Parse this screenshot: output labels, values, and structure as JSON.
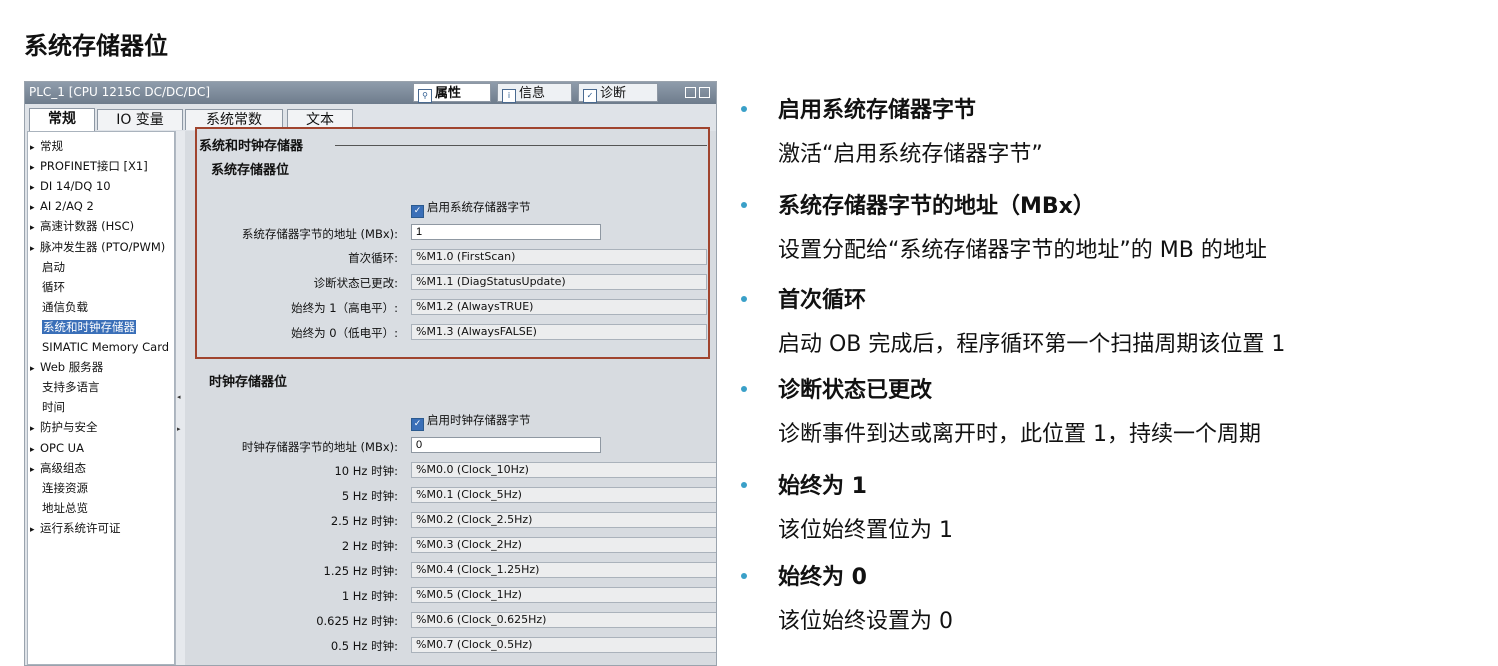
{
  "slide_title": "系统存储器位",
  "window": {
    "title": "PLC_1 [CPU 1215C DC/DC/DC]",
    "inspector_tabs": [
      {
        "label": "属性",
        "icon": "properties-icon"
      },
      {
        "label": "信息",
        "icon": "info-icon"
      },
      {
        "label": "诊断",
        "icon": "diagnostics-icon"
      }
    ],
    "sub_tabs": [
      "常规",
      "IO 变量",
      "系统常数",
      "文本"
    ]
  },
  "nav": {
    "items": [
      {
        "label": "常规",
        "arrow": "▸"
      },
      {
        "label": "PROFINET接口 [X1]",
        "arrow": "▸"
      },
      {
        "label": "DI 14/DQ 10",
        "arrow": "▸"
      },
      {
        "label": "AI 2/AQ 2",
        "arrow": "▸"
      },
      {
        "label": "高速计数器 (HSC)",
        "arrow": "▸"
      },
      {
        "label": "脉冲发生器 (PTO/PWM)",
        "arrow": "▸"
      },
      {
        "label": "启动",
        "arrow": ""
      },
      {
        "label": "循环",
        "arrow": ""
      },
      {
        "label": "通信负载",
        "arrow": ""
      },
      {
        "label": "系统和时钟存储器",
        "arrow": ""
      },
      {
        "label": "SIMATIC Memory Card",
        "arrow": ""
      },
      {
        "label": "Web 服务器",
        "arrow": "▸"
      },
      {
        "label": "支持多语言",
        "arrow": ""
      },
      {
        "label": "时间",
        "arrow": ""
      },
      {
        "label": "防护与安全",
        "arrow": "▸"
      },
      {
        "label": "OPC UA",
        "arrow": "▸"
      },
      {
        "label": "高级组态",
        "arrow": "▸"
      },
      {
        "label": "连接资源",
        "arrow": ""
      },
      {
        "label": "地址总览",
        "arrow": ""
      },
      {
        "label": "运行系统许可证",
        "arrow": "▸"
      }
    ]
  },
  "system_memory": {
    "group_title": "系统和时钟存储器",
    "title": "系统存储器位",
    "enable_label": "启用系统存储器字节",
    "address_label": "系统存储器字节的地址 (MBx):",
    "address_value": "1",
    "rows": [
      {
        "label": "首次循环:",
        "value": "%M1.0 (FirstScan)"
      },
      {
        "label": "诊断状态已更改:",
        "value": "%M1.1 (DiagStatusUpdate)"
      },
      {
        "label": "始终为 1（高电平）:",
        "value": "%M1.2 (AlwaysTRUE)"
      },
      {
        "label": "始终为 0（低电平）:",
        "value": "%M1.3 (AlwaysFALSE)"
      }
    ]
  },
  "clock_memory": {
    "title": "时钟存储器位",
    "enable_label": "启用时钟存储器字节",
    "address_label": "时钟存储器字节的地址 (MBx):",
    "address_value": "0",
    "rows": [
      {
        "label": "10 Hz 时钟:",
        "value": "%M0.0 (Clock_10Hz)"
      },
      {
        "label": "5 Hz 时钟:",
        "value": "%M0.1 (Clock_5Hz)"
      },
      {
        "label": "2.5 Hz 时钟:",
        "value": "%M0.2 (Clock_2.5Hz)"
      },
      {
        "label": "2 Hz 时钟:",
        "value": "%M0.3 (Clock_2Hz)"
      },
      {
        "label": "1.25 Hz 时钟:",
        "value": "%M0.4 (Clock_1.25Hz)"
      },
      {
        "label": "1 Hz 时钟:",
        "value": "%M0.5 (Clock_1Hz)"
      },
      {
        "label": "0.625 Hz 时钟:",
        "value": "%M0.6 (Clock_0.625Hz)"
      },
      {
        "label": "0.5 Hz 时钟:",
        "value": "%M0.7 (Clock_0.5Hz)"
      }
    ]
  },
  "bullets": [
    {
      "title": "启用系统存储器字节",
      "desc": "激活“启用系统存储器字节”"
    },
    {
      "title": "系统存储器字节的地址（MBx）",
      "desc": "设置分配给“系统存储器字节的地址”的 MB 的地址"
    },
    {
      "title": "首次循环",
      "desc": "启动 OB 完成后，程序循环第一个扫描周期该位置 1"
    },
    {
      "title": "诊断状态已更改",
      "desc": "诊断事件到达或离开时，此位置 1，持续一个周期"
    },
    {
      "title": "始终为 1",
      "desc": "该位始终置位为 1"
    },
    {
      "title": "始终为 0",
      "desc": "该位始终设置为 0"
    }
  ],
  "colors": {
    "bullet": "#3aa0c8",
    "highlight_border": "#a0442e",
    "selection": "#3a6fb8"
  }
}
